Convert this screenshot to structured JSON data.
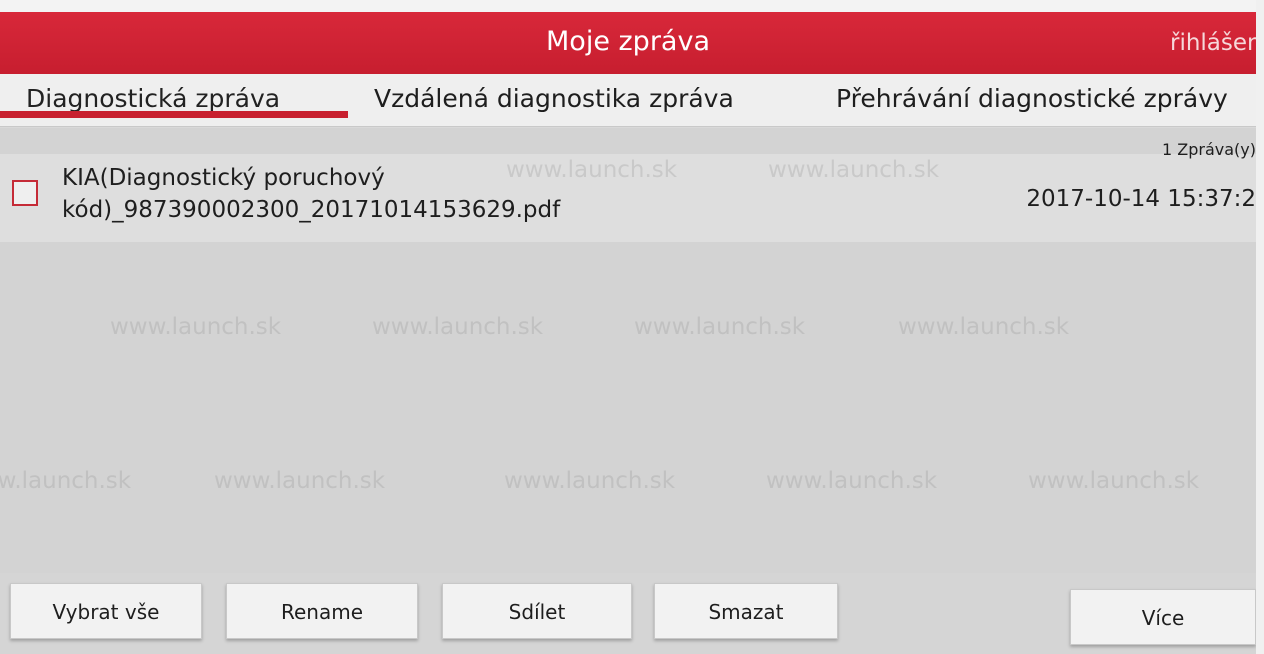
{
  "window": {
    "title": "Moje zpráva",
    "login_label": "řihlášeni"
  },
  "tabs": [
    {
      "label": "Diagnostická zpráva",
      "active": true
    },
    {
      "label": "Vzdálená diagnostika zpráva",
      "active": false
    },
    {
      "label": "Přehrávání diagnostické zprávy",
      "active": false
    }
  ],
  "report_list": {
    "count": "1 Zpráva(y)",
    "items": [
      {
        "filename_line1": "KIA(Diagnostický poruchový",
        "filename_line2": "kód)_987390002300_20171014153629.pdf",
        "date": "2017-10-14 15:37:2",
        "checked": false
      }
    ]
  },
  "buttons": {
    "select_all": "Vybrat vše",
    "rename": "Rename",
    "share": "Sdílet",
    "delete": "Smazat",
    "more": "Více"
  },
  "watermark": "www.launch.sk",
  "colors": {
    "accent": "#c8202f",
    "header_bg": "#d42536"
  }
}
